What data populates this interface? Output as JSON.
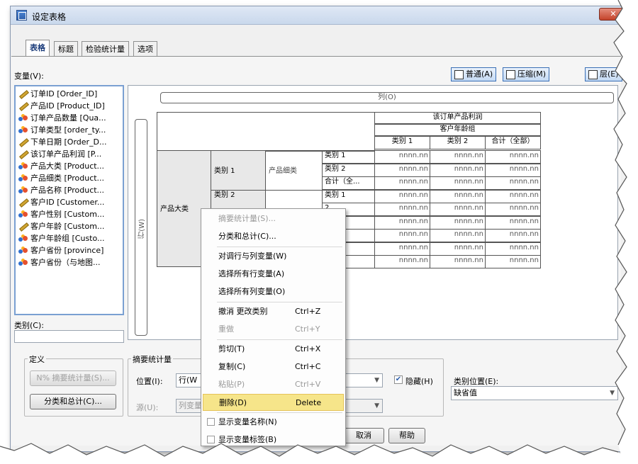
{
  "window": {
    "title": "设定表格",
    "close": "✕"
  },
  "tabs": [
    "表格",
    "标题",
    "检验统计量",
    "选项"
  ],
  "variables_label": "变量(V):",
  "variables": [
    {
      "label": "订单ID [Order_ID]",
      "icon": "scale"
    },
    {
      "label": "产品ID [Product_ID]",
      "icon": "scale"
    },
    {
      "label": "订单产品数量 [Qua...",
      "icon": "nominal"
    },
    {
      "label": "订单类型 [order_ty...",
      "icon": "nominal"
    },
    {
      "label": "下单日期 [Order_D...",
      "icon": "scale"
    },
    {
      "label": "该订单产品利润 [P...",
      "icon": "scale"
    },
    {
      "label": "产品大类 [Product...",
      "icon": "nominal"
    },
    {
      "label": "产品细类 [Product...",
      "icon": "nominal"
    },
    {
      "label": "产品名称 [Product...",
      "icon": "nominal"
    },
    {
      "label": "客户ID [Customer...",
      "icon": "scale"
    },
    {
      "label": "客户性别 [Custom...",
      "icon": "nominal"
    },
    {
      "label": "客户年龄 [Custom...",
      "icon": "scale"
    },
    {
      "label": "客户年龄组 [Custo...",
      "icon": "nominal"
    },
    {
      "label": "客户省份 [province]",
      "icon": "nominal"
    },
    {
      "label": "客户省份（与地图...",
      "icon": "nominal"
    }
  ],
  "category_label": "类别(C):",
  "view_buttons": {
    "normal": "普通(A)",
    "compact": "压缩(M)",
    "layer": "层(E)"
  },
  "canvas": {
    "columns_label": "列(O)",
    "rows_label": "行(W)",
    "col_header": "该订单产品利润",
    "col_sub": "客户年龄组",
    "col_cats": [
      "类别 1",
      "类别 2",
      "合计（全部）"
    ],
    "row_var": "产品大类",
    "row_cat1": "类别 1",
    "row_cat2": "类别 2",
    "row_sub": "产品细类",
    "row_labels": [
      "类别 1",
      "类别 2",
      "合计（全...",
      "类别 1",
      "2",
      "（全...",
      "1",
      "2",
      "（全..."
    ],
    "cell": "nnnn.nn"
  },
  "define": {
    "title": "定义",
    "summary_btn": "N% 摘要统计量(S)...",
    "cats_btn": "分类和总计(C)..."
  },
  "summary": {
    "title": "摘要统计量",
    "position_label": "位置(I):",
    "position_value": "行(W",
    "source_label": "源(U):",
    "source_value": "列变量",
    "hide_label": "隐藏(H)"
  },
  "category_position": {
    "label": "类别位置(E):",
    "value": "缺省值"
  },
  "bottom_buttons": {
    "cancel": "取消",
    "help": "帮助"
  },
  "context_menu": [
    {
      "label": "摘要统计量(S)...",
      "key": "",
      "disabled": true
    },
    {
      "label": "分类和总计(C)...",
      "key": "",
      "disabled": false
    },
    {
      "sep": true
    },
    {
      "label": "对调行与列变量(W)",
      "key": "",
      "disabled": false
    },
    {
      "label": "选择所有行变量(A)",
      "key": "",
      "disabled": false
    },
    {
      "label": "选择所有列变量(O)",
      "key": "",
      "disabled": false
    },
    {
      "sep": true
    },
    {
      "label": "撤消 更改类别",
      "key": "Ctrl+Z",
      "disabled": false
    },
    {
      "label": "重做",
      "key": "Ctrl+Y",
      "disabled": true
    },
    {
      "sep": true
    },
    {
      "label": "剪切(T)",
      "key": "Ctrl+X",
      "disabled": false
    },
    {
      "label": "复制(C)",
      "key": "Ctrl+C",
      "disabled": false
    },
    {
      "label": "粘贴(P)",
      "key": "Ctrl+V",
      "disabled": true
    },
    {
      "label": "删除(D)",
      "key": "Delete",
      "disabled": false,
      "selected": true
    },
    {
      "sep": true
    },
    {
      "label": "显示变量名称(N)",
      "key": "",
      "disabled": false,
      "check": true
    },
    {
      "label": "显示变量标签(B)",
      "key": "",
      "disabled": false,
      "check": true
    }
  ]
}
